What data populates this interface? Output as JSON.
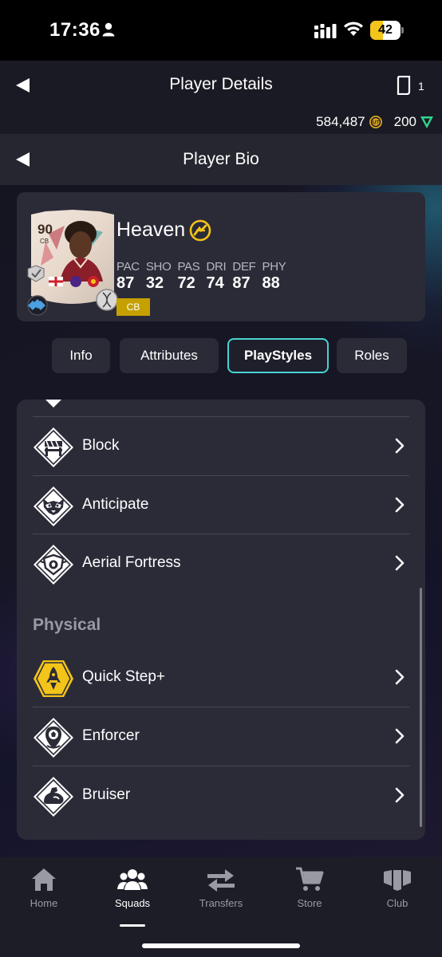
{
  "status_bar": {
    "time": "17:36",
    "battery": "42",
    "battery_level": 0.42
  },
  "header": {
    "title": "Player Details",
    "device_count": "1",
    "coins": "584,487",
    "points": "200"
  },
  "subheader": {
    "title": "Player Bio"
  },
  "player": {
    "name": "Heaven",
    "rating": "90",
    "position": "CB",
    "stats": [
      {
        "label": "PAC",
        "value": "87"
      },
      {
        "label": "SHO",
        "value": "32"
      },
      {
        "label": "PAS",
        "value": "72"
      },
      {
        "label": "DRI",
        "value": "74"
      },
      {
        "label": "DEF",
        "value": "87"
      },
      {
        "label": "PHY",
        "value": "88"
      }
    ]
  },
  "tabs": [
    {
      "label": "Info",
      "active": false
    },
    {
      "label": "Attributes",
      "active": false
    },
    {
      "label": "PlayStyles",
      "active": true
    },
    {
      "label": "Roles",
      "active": false
    }
  ],
  "playstyles": {
    "defending": [
      {
        "label": "Block",
        "icon": "block-icon",
        "plus": false
      },
      {
        "label": "Anticipate",
        "icon": "anticipate-icon",
        "plus": false
      },
      {
        "label": "Aerial Fortress",
        "icon": "aerial-fortress-icon",
        "plus": false
      }
    ],
    "physical_title": "Physical",
    "physical": [
      {
        "label": "Quick Step+",
        "icon": "quick-step-icon",
        "plus": true
      },
      {
        "label": "Enforcer",
        "icon": "enforcer-icon",
        "plus": false
      },
      {
        "label": "Bruiser",
        "icon": "bruiser-icon",
        "plus": false
      }
    ]
  },
  "nav": [
    {
      "label": "Home",
      "icon": "home-icon",
      "active": false
    },
    {
      "label": "Squads",
      "icon": "squads-icon",
      "active": true
    },
    {
      "label": "Transfers",
      "icon": "transfers-icon",
      "active": false
    },
    {
      "label": "Store",
      "icon": "store-icon",
      "active": false
    },
    {
      "label": "Club",
      "icon": "club-icon",
      "active": false
    }
  ],
  "colors": {
    "accent": "#49d2d2",
    "gold": "#f3c419",
    "panel": "#2b2b38",
    "position_badge": "#c5a000"
  }
}
